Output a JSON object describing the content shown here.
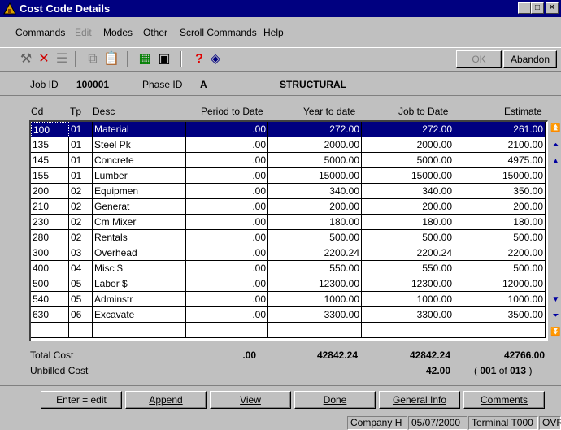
{
  "window": {
    "title": "Cost Code Details"
  },
  "menu": {
    "commands": "Commands",
    "edit": "Edit",
    "modes": "Modes",
    "other": "Other",
    "scroll_commands": "Scroll Commands",
    "help": "Help"
  },
  "toolbar": {
    "ok_label": "OK",
    "abandon_label": "Abandon",
    "help_glyph": "?"
  },
  "header": {
    "job_label": "Job ID",
    "job_value": "100001",
    "phase_label": "Phase ID",
    "phase_value": "A",
    "description": "STRUCTURAL"
  },
  "columns": [
    "Cd",
    "Tp",
    "Desc",
    "Period to Date",
    "Year to date",
    "Job to Date",
    "Estimate"
  ],
  "rows": [
    [
      "100",
      "01",
      "Material",
      ".00",
      "272.00",
      "272.00",
      "261.00"
    ],
    [
      "135",
      "01",
      "Steel Pk",
      ".00",
      "2000.00",
      "2000.00",
      "2100.00"
    ],
    [
      "145",
      "01",
      "Concrete",
      ".00",
      "5000.00",
      "5000.00",
      "4975.00"
    ],
    [
      "155",
      "01",
      "Lumber",
      ".00",
      "15000.00",
      "15000.00",
      "15000.00"
    ],
    [
      "200",
      "02",
      "Equipmen",
      ".00",
      "340.00",
      "340.00",
      "350.00"
    ],
    [
      "210",
      "02",
      "Generat",
      ".00",
      "200.00",
      "200.00",
      "200.00"
    ],
    [
      "230",
      "02",
      "Cm Mixer",
      ".00",
      "180.00",
      "180.00",
      "180.00"
    ],
    [
      "280",
      "02",
      "Rentals",
      ".00",
      "500.00",
      "500.00",
      "500.00"
    ],
    [
      "300",
      "03",
      "Overhead",
      ".00",
      "2200.24",
      "2200.24",
      "2200.00"
    ],
    [
      "400",
      "04",
      "Misc $",
      ".00",
      "550.00",
      "550.00",
      "500.00"
    ],
    [
      "500",
      "05",
      "Labor $",
      ".00",
      "12300.00",
      "12300.00",
      "12000.00"
    ],
    [
      "540",
      "05",
      "Adminstr",
      ".00",
      "1000.00",
      "1000.00",
      "1000.00"
    ],
    [
      "630",
      "06",
      "Excavate",
      ".00",
      "3300.00",
      "3300.00",
      "3500.00"
    ],
    [
      "",
      "",
      "",
      "",
      "",
      "",
      ""
    ]
  ],
  "totals": {
    "total_label": "Total Cost",
    "period": ".00",
    "year": "42842.24",
    "job": "42842.24",
    "estimate": "42766.00",
    "unbilled_label": "Unbilled Cost",
    "unbilled_value": "42.00",
    "record_open": "(",
    "record_current": "001",
    "record_of": "of",
    "record_total": "013",
    "record_close": ")"
  },
  "buttons": {
    "enter_edit": "Enter = edit",
    "append": "Append",
    "view": "View",
    "done": "Done",
    "general_info": "General Info",
    "comments": "Comments"
  },
  "status": {
    "company": "Company H",
    "date": "05/07/2000",
    "terminal": "Terminal T000",
    "mode": "OVR"
  },
  "colors": {
    "titlebar": "#000080",
    "selection": "#000080",
    "face": "#c0c0c0"
  }
}
